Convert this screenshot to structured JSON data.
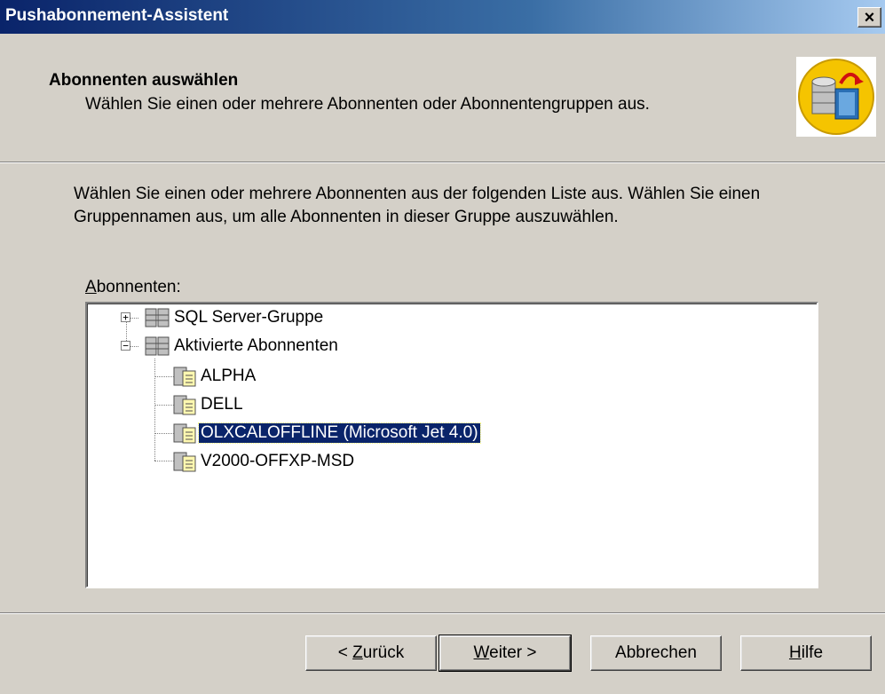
{
  "window": {
    "title": "Pushabonnement-Assistent",
    "close_glyph": "×"
  },
  "header": {
    "title": "Abonnenten auswählen",
    "subtitle": "Wählen Sie einen oder mehrere Abonnenten oder Abonnentengruppen aus.",
    "icon": "database-publish-icon"
  },
  "main": {
    "description": "Wählen Sie einen oder mehrere Abonnenten aus der folgenden Liste aus. Wählen Sie einen Gruppennamen aus, um alle Abonnenten in dieser Gruppe auszuwählen.",
    "list_label": "Abonnenten:",
    "tree": [
      {
        "label": "SQL Server-Gruppe",
        "expander": "+",
        "icon": "server-group-icon"
      },
      {
        "label": "Aktivierte Abonnenten",
        "expander": "−",
        "icon": "server-group-icon"
      },
      {
        "label": "ALPHA",
        "icon": "subscriber-icon"
      },
      {
        "label": "DELL",
        "icon": "subscriber-icon"
      },
      {
        "label": "OLXCALOFFLINE (Microsoft Jet 4.0)",
        "icon": "subscriber-icon",
        "selected": true
      },
      {
        "label": "V2000-OFFXP-MSD",
        "icon": "subscriber-icon"
      }
    ]
  },
  "buttons": {
    "back": "< Zurück",
    "next": "Weiter >",
    "cancel": "Abbrechen",
    "help": "Hilfe"
  },
  "colors": {
    "titlebar_start": "#0a246a",
    "titlebar_end": "#a6caf0",
    "dialog_bg": "#d4d0c8",
    "selection": "#0a246a"
  }
}
